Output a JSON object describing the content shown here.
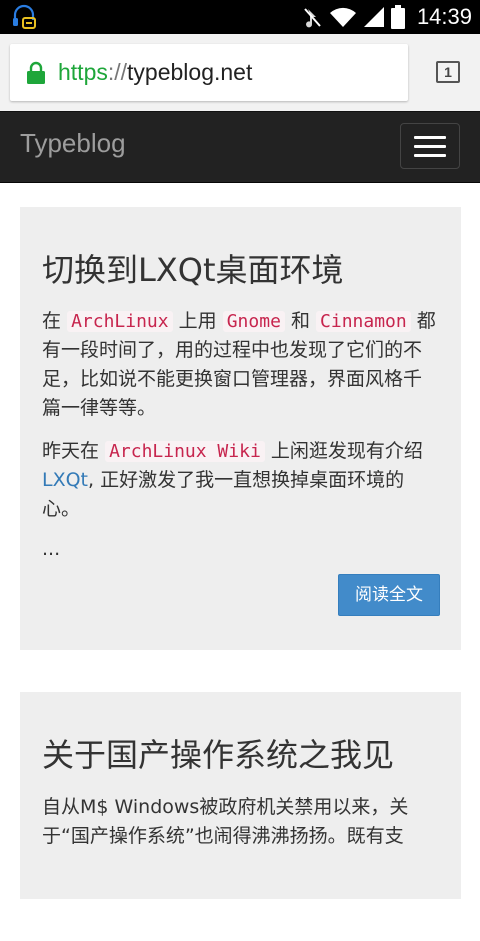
{
  "status_bar": {
    "time": "14:39",
    "icons": [
      "headset-notification-icon",
      "mute-icon",
      "wifi-icon",
      "signal-icon",
      "battery-icon"
    ]
  },
  "browser": {
    "url_scheme": "https",
    "url_separator": "://",
    "url_host": "typeblog.net",
    "tab_count": "1",
    "lock_color": "#1ea63a"
  },
  "navbar": {
    "brand": "Typeblog"
  },
  "posts": [
    {
      "title": "切换到LXQt桌面环境",
      "p1_prefix": "在",
      "p1_code1": "ArchLinux",
      "p1_mid1": "上用",
      "p1_code2": "Gnome",
      "p1_mid2": "和",
      "p1_code3": "Cinnamon",
      "p1_rest": "都有一段时间了，用的过程中也发现了它们的不足，比如说不能更换窗口管理器，界面风格千篇一律等等。",
      "p2_prefix": "昨天在",
      "p2_code": "ArchLinux Wiki",
      "p2_mid": "上闲逛发现有介绍",
      "p2_link": "LXQt",
      "p2_rest": ", 正好激发了我一直想换掉桌面环境的心。",
      "ellipsis": "...",
      "read_more": "阅读全文"
    },
    {
      "title": "关于国产操作系统之我见",
      "p1": "自从M$ Windows被政府机关禁用以来，关于“国产操作系统”也闹得沸沸扬扬。既有支"
    }
  ]
}
